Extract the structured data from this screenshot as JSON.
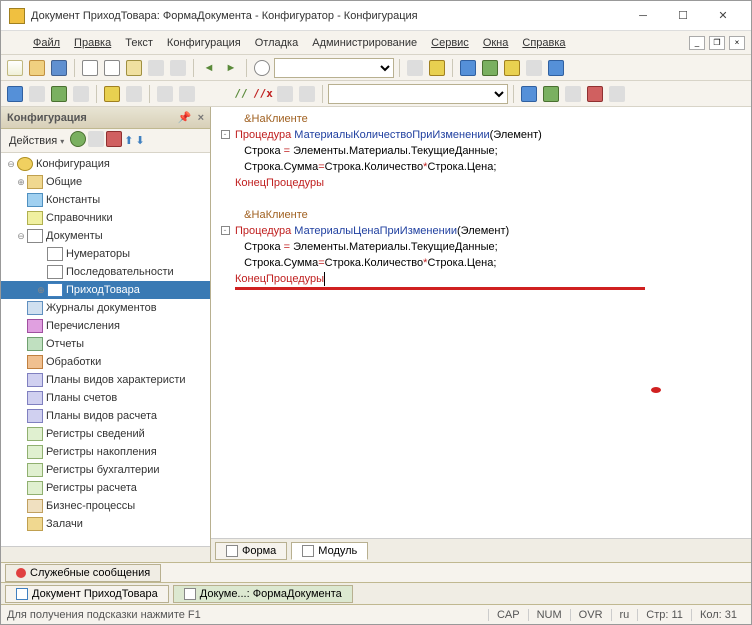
{
  "window": {
    "title": "Документ ПриходТовара: ФормаДокумента - Конфигуратор - Конфигурация"
  },
  "menu": {
    "file": "Файл",
    "edit": "Правка",
    "text": "Текст",
    "config": "Конфигурация",
    "debug": "Отладка",
    "admin": "Администрирование",
    "service": "Сервис",
    "windows": "Окна",
    "help": "Справка"
  },
  "sidebar": {
    "title": "Конфигурация",
    "actions_label": "Действия",
    "items": {
      "root": "Конфигурация",
      "common": "Общие",
      "constants": "Константы",
      "refs": "Справочники",
      "docs": "Документы",
      "numerators": "Нумераторы",
      "sequences": "Последовательности",
      "incoming": "ПриходТовара",
      "journals": "Журналы документов",
      "enums": "Перечисления",
      "reports": "Отчеты",
      "processing": "Обработки",
      "char_plans": "Планы видов характеристи",
      "acc_plans": "Планы счетов",
      "calc_plans": "Планы видов расчета",
      "info_regs": "Регистры сведений",
      "accum_regs": "Регистры накопления",
      "acc_regs": "Регистры бухгалтерии",
      "calc_regs": "Регистры расчета",
      "bp": "Бизнес-процессы",
      "tasks": "Залачи"
    }
  },
  "code": {
    "l1": "&НаКлиенте",
    "l2a": "Процедура ",
    "l2b": "МатериалыКоличествоПриИзменении",
    "l2c": "(Элемент)",
    "l3a": "Строка ",
    "l3b": "= ",
    "l3c": "Элементы.Материалы.ТекущиеДанные;",
    "l4a": "Строка.Сумма",
    "l4b": "=",
    "l4c": "Строка.Количество",
    "l4d": "*",
    "l4e": "Строка.Цена;",
    "l5": "КонецПроцедуры",
    "l7": "&НаКлиенте",
    "l8a": "Процедура ",
    "l8b": "МатериалыЦенаПриИзменении",
    "l8c": "(Элемент)",
    "l9a": "Строка ",
    "l9b": "= ",
    "l9c": "Элементы.Материалы.ТекущиеДанные;",
    "l10a": "Строка.Сумма",
    "l10b": "=",
    "l10c": "Строка.Количество",
    "l10d": "*",
    "l10e": "Строка.Цена;",
    "l11": "КонецПроцедуры"
  },
  "editor_tabs": {
    "form": "Форма",
    "module": "Модуль"
  },
  "messages": {
    "label": "Служебные сообщения"
  },
  "window_tabs": {
    "t1": "Документ ПриходТовара",
    "t2": "Докуме...: ФормаДокумента"
  },
  "status": {
    "hint": "Для получения подсказки нажмите F1",
    "cap": "CAP",
    "num": "NUM",
    "ovr": "OVR",
    "lang": "ru",
    "row_label": "Стр: 11",
    "col_label": "Кол: 31"
  }
}
